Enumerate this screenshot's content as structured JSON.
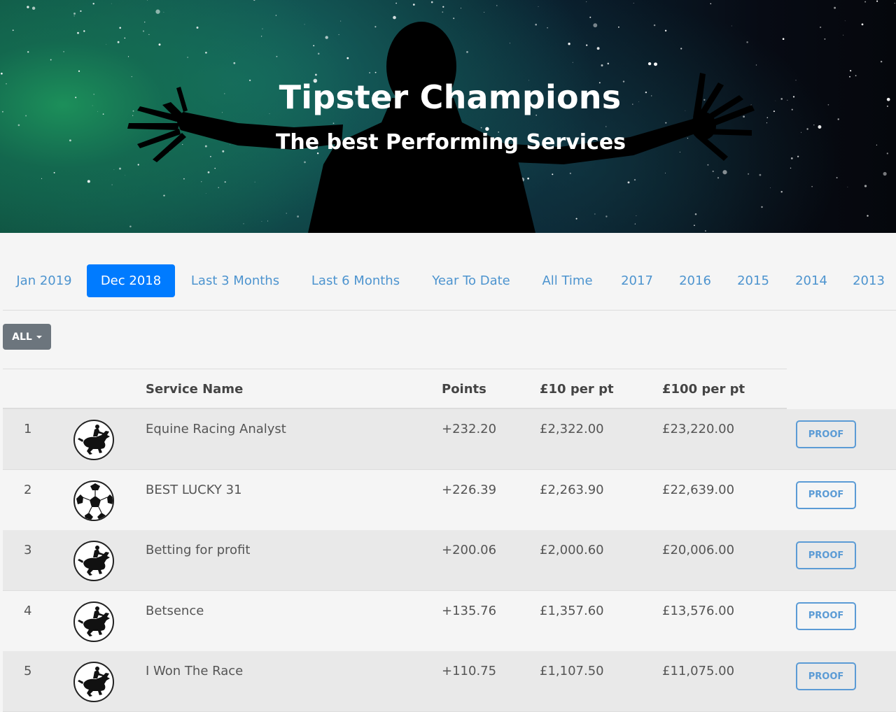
{
  "hero": {
    "title": "Tipster Champions",
    "subtitle": "The best Performing Services"
  },
  "tabs": [
    {
      "label": "Jan 2019",
      "active": false
    },
    {
      "label": "Dec 2018",
      "active": true
    },
    {
      "label": "Last 3 Months",
      "active": false
    },
    {
      "label": "Last 6 Months",
      "active": false
    },
    {
      "label": "Year To Date",
      "active": false
    },
    {
      "label": "All Time",
      "active": false
    },
    {
      "label": "2017",
      "active": false
    },
    {
      "label": "2016",
      "active": false
    },
    {
      "label": "2015",
      "active": false
    },
    {
      "label": "2014",
      "active": false
    },
    {
      "label": "2013",
      "active": false
    }
  ],
  "filter": {
    "label": "ALL"
  },
  "table": {
    "headers": {
      "rank": "",
      "icon": "",
      "name": "Service Name",
      "points": "Points",
      "per10": "£10 per pt",
      "per100": "£100 per pt"
    },
    "rows": [
      {
        "rank": "1",
        "icon": "horse-racing-icon",
        "name": "Equine Racing Analyst",
        "points": "+232.20",
        "per10": "£2,322.00",
        "per100": "£23,220.00",
        "action": "PROOF"
      },
      {
        "rank": "2",
        "icon": "football-icon",
        "name": "BEST LUCKY 31",
        "points": "+226.39",
        "per10": "£2,263.90",
        "per100": "£22,639.00",
        "action": "PROOF"
      },
      {
        "rank": "3",
        "icon": "horse-racing-icon",
        "name": "Betting for profit",
        "points": "+200.06",
        "per10": "£2,000.60",
        "per100": "£20,006.00",
        "action": "PROOF"
      },
      {
        "rank": "4",
        "icon": "horse-racing-icon",
        "name": "Betsence",
        "points": "+135.76",
        "per10": "£1,357.60",
        "per100": "£13,576.00",
        "action": "PROOF"
      },
      {
        "rank": "5",
        "icon": "horse-racing-icon",
        "name": "I Won The Race",
        "points": "+110.75",
        "per10": "£1,107.50",
        "per100": "£11,075.00",
        "action": "PROOF"
      }
    ]
  },
  "colors": {
    "accent": "#007bff",
    "tab_text": "#4d94cf",
    "proof": "#5b9bd5",
    "filter_bg": "#6c757d"
  }
}
